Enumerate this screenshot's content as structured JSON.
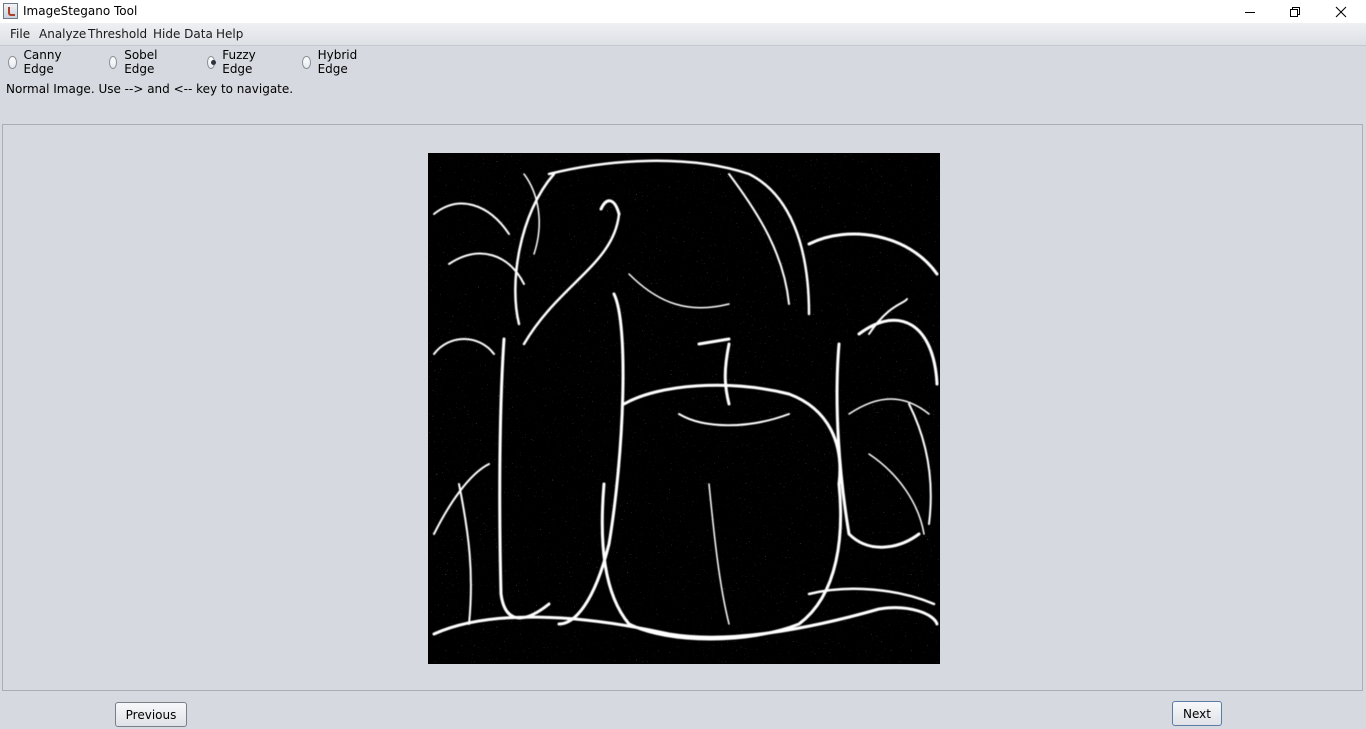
{
  "window": {
    "title": "ImageStegano Tool",
    "icon": "java-app-icon",
    "controls": [
      "minimize-icon",
      "restore-icon",
      "close-icon"
    ]
  },
  "menubar": {
    "items": [
      {
        "label": "File"
      },
      {
        "label": "Analyze"
      },
      {
        "label": "Threshold"
      },
      {
        "label": "Hide Data"
      },
      {
        "label": "Help"
      }
    ]
  },
  "edge_options": {
    "selected": "Fuzzy Edge",
    "items": [
      {
        "label": "Canny Edge",
        "selected": false
      },
      {
        "label": "Sobel Edge",
        "selected": false
      },
      {
        "label": "Fuzzy Edge",
        "selected": true
      },
      {
        "label": "Hybrid Edge",
        "selected": false
      }
    ]
  },
  "status": "Normal Image. Use --> and <-- key to navigate.",
  "image": {
    "content": "edge-detected image of bell peppers (white edges on black)"
  },
  "navigation": {
    "previous_label": "Previous",
    "next_label": "Next"
  },
  "colors": {
    "window_bg": "#d6d9df",
    "titlebar_bg": "#ffffff",
    "image_bg": "#000000",
    "edge_color": "#ffffff"
  }
}
